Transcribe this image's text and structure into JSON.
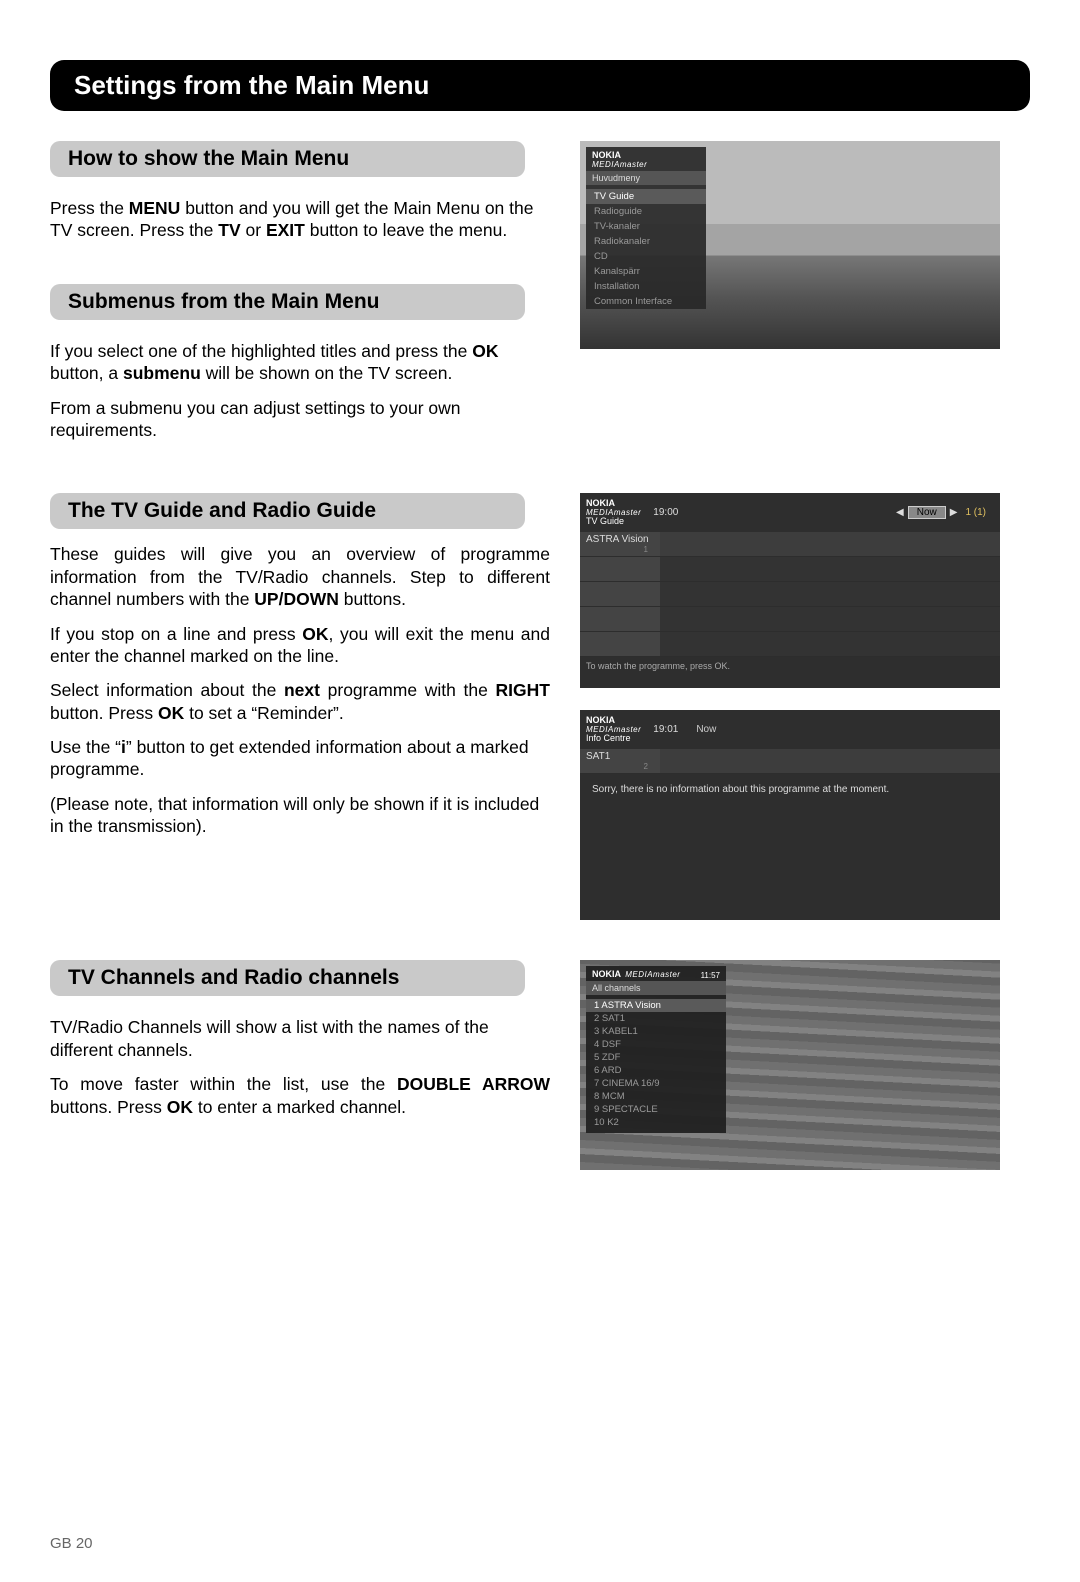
{
  "page_title": "Settings from the Main Menu",
  "footer": "GB 20",
  "brand": {
    "name": "NOKIA",
    "model": "MEDIAmaster"
  },
  "sections": {
    "show_main": {
      "heading": "How to show the Main Menu",
      "p1_a": "Press the ",
      "p1_b": " button and you will get the Main Menu on the TV screen. Press the ",
      "p1_c": " or ",
      "p1_d": " button to leave the menu.",
      "b1": "MENU",
      "b2": "TV",
      "b3": "EXIT"
    },
    "submenus": {
      "heading": "Submenus from the Main Menu",
      "p1_a": "If you select one of the highlighted titles and press the ",
      "p1_b": " button, a ",
      "p1_c": " will be shown on the TV screen.",
      "b1": "OK",
      "b2": "submenu",
      "p2": "From a submenu you can adjust settings to your own requirements."
    },
    "guides": {
      "heading": "The TV Guide and Radio Guide",
      "p1_a": "These guides will give you an overview of programme information from the TV/Radio channels. Step to different channel numbers with the ",
      "p1_b": " buttons.",
      "b1": "UP/DOWN",
      "p2_a": "If you stop on a line and press ",
      "p2_b": ", you will exit the menu and enter the channel marked on the line.",
      "b2": "OK",
      "p3_a": "Select information about the ",
      "p3_b": " programme with the ",
      "p3_c": " button. Press ",
      "p3_d": " to set a “Reminder”.",
      "b3": "next",
      "b4": "RIGHT",
      "b5": "OK",
      "p4_a": "Use the “",
      "p4_b": "” button to get extended information about a marked programme.",
      "b6": "i",
      "p5": "(Please note, that information will only be shown if it is included in the transmission)."
    },
    "channels": {
      "heading": "TV Channels and Radio channels",
      "p1": "TV/Radio Channels will show a list with the names of the different channels.",
      "p2_a": "To move faster within the list, use the ",
      "p2_b": " buttons. Press ",
      "p2_c": " to enter a marked channel.",
      "b1": "DOUBLE ARROW",
      "b2": "OK"
    }
  },
  "osd_menu": {
    "title": "Huvudmeny",
    "items": [
      "TV Guide",
      "Radioguide",
      "TV-kanaler",
      "Radiokanaler",
      "CD",
      "Kanalspärr",
      "Installation",
      "Common Interface"
    ],
    "highlight_index": 0
  },
  "osd_tvguide": {
    "label": "TV Guide",
    "time": "19:00",
    "now": "Now",
    "page": "1 (1)",
    "channel": "ASTRA Vision",
    "ch_no": "1",
    "footer": "To watch the programme, press OK."
  },
  "osd_info": {
    "label": "Info Centre",
    "time": "19:01",
    "now": "Now",
    "channel": "SAT1",
    "ch_no": "2",
    "msg": "Sorry, there is no information about this programme at the moment."
  },
  "osd_channels": {
    "label": "All channels",
    "time": "11:57",
    "items": [
      "1 ASTRA Vision",
      "2 SAT1",
      "3 KABEL1",
      "4 DSF",
      "5 ZDF",
      "6 ARD",
      "7 CINEMA 16/9",
      "8 MCM",
      "9 SPECTACLE",
      "10 K2"
    ],
    "highlight_index": 0
  }
}
